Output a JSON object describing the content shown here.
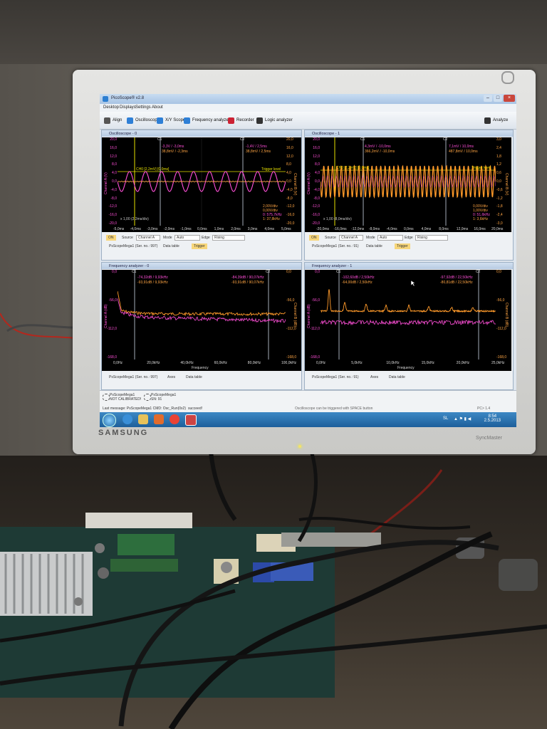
{
  "monitor": {
    "brand": "SAMSUNG",
    "model": "SyncMaster"
  },
  "app": {
    "title": "PicoScope® v2.8",
    "menus": [
      "Desktop",
      "Displays",
      "Settings",
      "About"
    ],
    "toolbar": [
      "Align",
      "Oscilloscope",
      "X/Y Scope",
      "Frequency analyzer",
      "Recorder",
      "Logic analyzer"
    ],
    "analyze_label": "Analyze"
  },
  "osc0": {
    "title": "Oscilloscope - 0",
    "c1": "C1",
    "c2": "C2",
    "c1_readout_a": "-3,3V / -3,0ms",
    "c1_readout_b": "38,8mV / -2,3ms",
    "c2_readout_a": "-1,4V / 2,5ms",
    "c2_readout_b": "38,8mV / 2,5ms",
    "trigger_left": "CH0 [2,2mV]  [0,0ms]",
    "trigger_right": "Trigger level",
    "zoom": "x 1,00 (2,2ms/div)",
    "scale_info": [
      "2,00V/div",
      "0,00V/div",
      "0: 575,7kHz",
      "1: 37,8kHz"
    ],
    "y_left": [
      "20,0",
      "16,0",
      "12,0",
      "8,0",
      "4,0",
      "0,0",
      "-4,0",
      "-8,0",
      "-12,0",
      "-16,0",
      "-20,0"
    ],
    "y_right": [
      "20,0",
      "16,0",
      "12,0",
      "8,0",
      "4,0",
      "0,0",
      "-4,0",
      "-8,0",
      "-12,0",
      "-16,0",
      "-20,0"
    ],
    "x_ticks": [
      "-5,0ms",
      "-4,0ms",
      "-3,0ms",
      "-2,0ms",
      "-1,0ms",
      "0,0ms",
      "1,0ms",
      "2,0ms",
      "3,0ms",
      "4,0ms",
      "5,0ms"
    ],
    "y_label_left": "Channel A (V)",
    "y_label_right": "Channel B (V)",
    "on_label": "ON",
    "source_label": "Source",
    "source_value": "Channel A",
    "mode_label": "Mode",
    "mode_value": "Auto",
    "edge_label": "Edge",
    "edge_value": "Rising",
    "device": "PsScopeMega1 (Ser. no.: 997)",
    "data_table": "Data table",
    "trigger_btn": "Trigger"
  },
  "osc1": {
    "title": "Oscilloscope - 1",
    "c1": "C1",
    "c2": "C2",
    "c1_readout_a": "4,3mV / -10,0ms",
    "c1_readout_b": "366,2mV / -10,0ms",
    "c2_readout_a": "7,1mV / 10,0ms",
    "c2_readout_b": "487,8mV / 10,0ms",
    "trigger_left": "CH0 [2,2mV]  [0,0ms]",
    "trigger_right": "Trigger level",
    "zoom": "x 1,00 (8,0ms/div)",
    "scale_info": [
      "0,00V/div",
      "1,00V/div",
      "0: 51,6kHz",
      "1: 3,6kHz"
    ],
    "y_left": [
      "20,0",
      "16,0",
      "12,0",
      "8,0",
      "4,0",
      "0,0",
      "-4,0",
      "-8,0",
      "-12,0",
      "-16,0",
      "-20,0"
    ],
    "y_right": [
      "3,0",
      "2,4",
      "1,8",
      "1,2",
      "0,6",
      "0,0",
      "-0,6",
      "-1,2",
      "-1,8",
      "-2,4",
      "-3,0"
    ],
    "x_ticks": [
      "-20,0ms",
      "-16,0ms",
      "-12,0ms",
      "-8,0ms",
      "-4,0ms",
      "0,0ms",
      "4,0ms",
      "8,0ms",
      "12,0ms",
      "16,0ms",
      "20,0ms"
    ],
    "y_label_left": "Channel A (V)",
    "y_label_right": "Channel B (V)",
    "on_label": "ON",
    "source_label": "Source",
    "source_value": "Channel A",
    "mode_label": "Mode",
    "mode_value": "Auto",
    "edge_label": "Edge",
    "edge_value": "Rising",
    "device": "PsScopeMega1 (Ser. no.: 91)",
    "data_table": "Data table",
    "trigger_btn": "Trigger"
  },
  "fa0": {
    "title": "Frequency analyzer - 0",
    "c1": "C1",
    "c2": "C2",
    "c1_readout_a": "-74,32dB / 9,93kHz",
    "c1_readout_b": "-93,91dB / 9,93kHz",
    "c2_readout_a": "-84,39dB / 90,07kHz",
    "c2_readout_b": "-93,91dB / 90,07kHz",
    "y_left": [
      "0,0",
      "-56,0",
      "-112,0",
      "-168,0"
    ],
    "y_right": [
      "0,0",
      "-56,0",
      "-112,0",
      "-168,0"
    ],
    "x_ticks": [
      "0,0Hz",
      "20,0kHz",
      "40,0kHz",
      "60,0kHz",
      "80,0kHz",
      "100,0kHz"
    ],
    "x_label": "Frequency",
    "y_label_left": "Channel A (dB)",
    "y_label_right": "Channel B (dB)",
    "device": "PsScopeMega1 (Ser. no.: 997)",
    "axes": "Axes",
    "data_table": "Data table"
  },
  "fa1": {
    "title": "Frequency analyzer - 1",
    "c1": "C1",
    "c2": "C2",
    "c1_readout_a": "-102,60dB / 2,50kHz",
    "c1_readout_b": "-64,00dB / 2,50kHz",
    "c2_readout_a": "-97,92dB / 22,50kHz",
    "c2_readout_b": "-80,81dB / 22,50kHz",
    "y_left": [
      "0,0",
      "-56,0",
      "-112,0",
      "-168,0"
    ],
    "y_right": [
      "0,0",
      "-56,0",
      "-112,0",
      "-168,0"
    ],
    "x_ticks": [
      "0,0Hz",
      "5,0kHz",
      "10,0kHz",
      "15,0kHz",
      "20,0kHz",
      "25,0kHz"
    ],
    "x_label": "Frequency",
    "y_label_left": "Channel A (dB)",
    "y_label_right": "Channel B (dB)",
    "device": "PsScopeMega1 (Ser. no.: 91)",
    "axes": "Axes",
    "data_table": "Data table"
  },
  "status": {
    "dev0_name": "PsScopeMega1",
    "dev0_state": "NOT CALIBRATED!",
    "dev1_name": "PsScopeMega1",
    "dev1_state": "SN: 91",
    "last_message": "Last message: PsScopeMega1 CMD: Osc_Run(0x2)",
    "result": "succeed!",
    "hint": "Oscilloscope can be triggered with SPACE button",
    "version": "PC> 1.4"
  },
  "taskbar": {
    "lang": "SL",
    "time": "8:54",
    "date": "2.5.2013"
  },
  "colors": {
    "pink": "#ff4fd8",
    "orange": "#ff9a2a",
    "yellow": "#f2e200",
    "cursor": "#cfd8e6"
  }
}
